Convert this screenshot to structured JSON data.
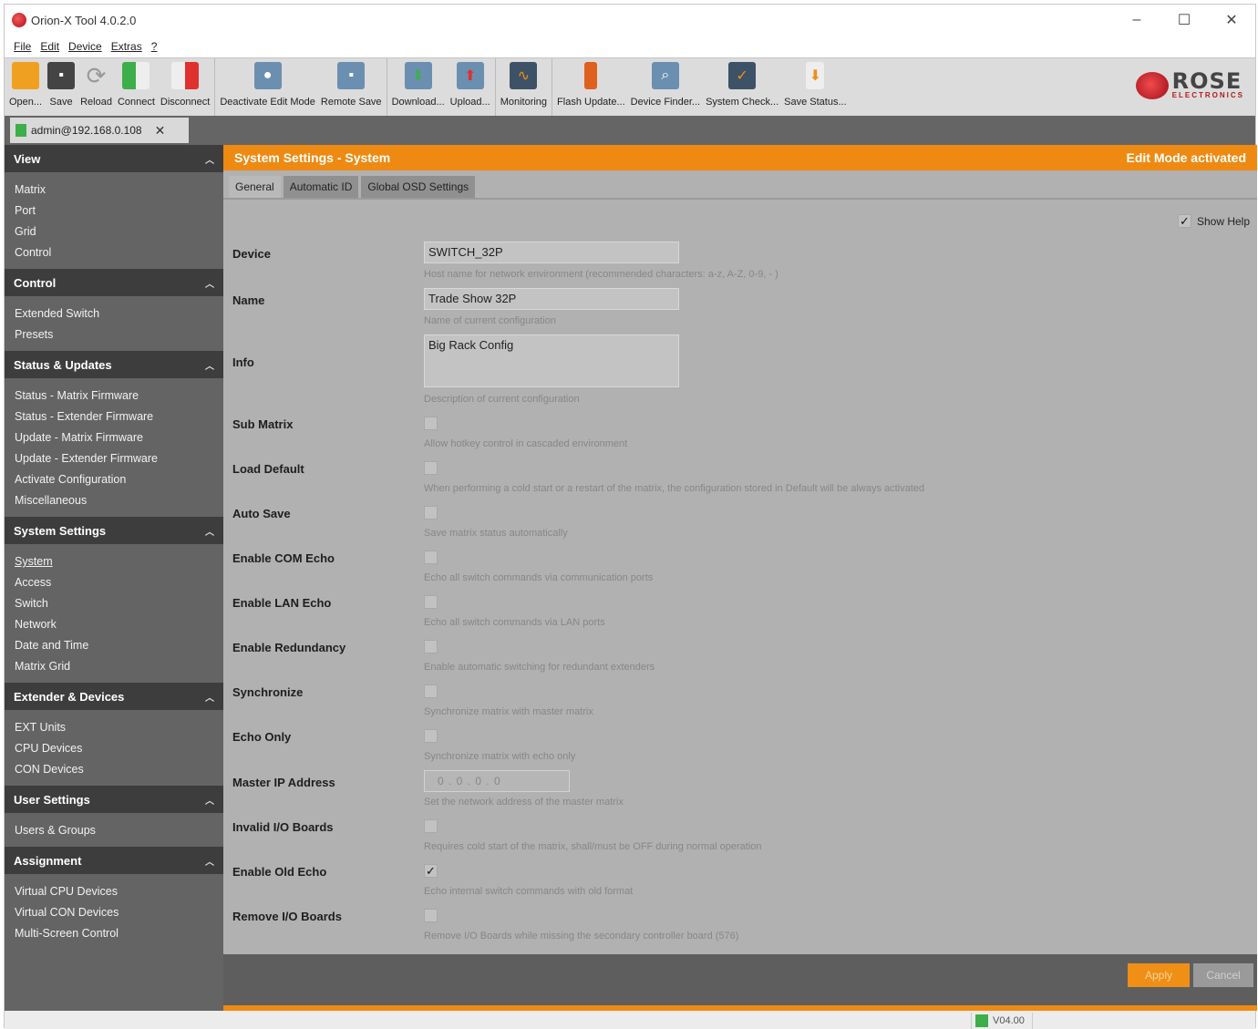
{
  "window": {
    "title": "Orion-X Tool 4.0.2.0",
    "minimize": "–",
    "maximize": "☐",
    "close": "✕"
  },
  "menu": [
    "File",
    "Edit",
    "Device",
    "Extras",
    "?"
  ],
  "toolbar": {
    "group1": [
      {
        "label": "Open...",
        "icon": "folder-icon",
        "color": "#f0a020"
      },
      {
        "label": "Save",
        "icon": "save-icon",
        "color": "#444444"
      },
      {
        "label": "Reload",
        "icon": "reload-icon",
        "color": "#aaaaaa"
      },
      {
        "label": "Connect",
        "icon": "connect-icon",
        "color": "#3eae4a"
      },
      {
        "label": "Disconnect",
        "icon": "disconnect-icon",
        "color": "#e03030"
      }
    ],
    "group2": [
      {
        "label": "Deactivate Edit Mode",
        "icon": "edit-mode-icon",
        "color": "#6b8fb0"
      },
      {
        "label": "Remote Save",
        "icon": "remote-save-icon",
        "color": "#6b8fb0"
      }
    ],
    "group3": [
      {
        "label": "Download...",
        "icon": "download-icon",
        "color": "#6b8fb0"
      },
      {
        "label": "Upload...",
        "icon": "upload-icon",
        "color": "#6b8fb0"
      }
    ],
    "group4": [
      {
        "label": "Monitoring",
        "icon": "monitoring-icon",
        "color": "#3d5266"
      }
    ],
    "group5": [
      {
        "label": "Flash Update...",
        "icon": "flash-update-icon",
        "color": "#e06020"
      },
      {
        "label": "Device Finder...",
        "icon": "device-finder-icon",
        "color": "#6b8fb0"
      },
      {
        "label": "System Check...",
        "icon": "system-check-icon",
        "color": "#3d5266"
      },
      {
        "label": "Save Status...",
        "icon": "save-status-icon",
        "color": "#eeeeee"
      }
    ],
    "brand": {
      "name": "ROSE",
      "sub": "ELECTRONICS"
    }
  },
  "session": {
    "label": "admin@192.168.0.108",
    "close": "✕"
  },
  "sidebar": {
    "sections": [
      {
        "title": "View",
        "items": [
          "Matrix",
          "Port",
          "Grid",
          "Control"
        ]
      },
      {
        "title": "Control",
        "items": [
          "Extended Switch",
          "Presets"
        ]
      },
      {
        "title": "Status & Updates",
        "items": [
          "Status - Matrix Firmware",
          "Status - Extender Firmware",
          "Update - Matrix Firmware",
          "Update - Extender Firmware",
          "Activate Configuration",
          "Miscellaneous"
        ]
      },
      {
        "title": "System Settings",
        "items": [
          "System",
          "Access",
          "Switch",
          "Network",
          "Date and Time",
          "Matrix Grid"
        ]
      },
      {
        "title": "Extender & Devices",
        "items": [
          "EXT Units",
          "CPU Devices",
          "CON Devices"
        ]
      },
      {
        "title": "User Settings",
        "items": [
          "Users & Groups"
        ]
      },
      {
        "title": "Assignment",
        "items": [
          "Virtual CPU Devices",
          "Virtual CON Devices",
          "Multi-Screen Control"
        ]
      }
    ],
    "active_item": "System"
  },
  "main": {
    "header_title": "System Settings - System",
    "header_status": "Edit Mode activated",
    "tabs": [
      "General",
      "Automatic ID",
      "Global OSD Settings"
    ],
    "show_help": {
      "label": "Show Help",
      "checked": "✓"
    },
    "device": {
      "label": "Device",
      "value": "SWITCH_32P",
      "help": "Host name for network environment (recommended characters: a-z, A-Z, 0-9, - )"
    },
    "name": {
      "label": "Name",
      "value": "Trade Show 32P",
      "help": "Name of current configuration"
    },
    "info": {
      "label": "Info",
      "value": "Big Rack Config",
      "help": "Description of current configuration"
    },
    "checks": [
      {
        "label": "Sub Matrix",
        "help": "Allow hotkey control in cascaded environment",
        "mark": ""
      },
      {
        "label": "Load Default",
        "help": "When performing a cold start or a restart of the matrix, the configuration stored in Default will be always activated",
        "mark": ""
      },
      {
        "label": "Auto Save",
        "help": "Save matrix status automatically",
        "mark": ""
      },
      {
        "label": "Enable COM Echo",
        "help": "Echo all switch commands via communication ports",
        "mark": ""
      },
      {
        "label": "Enable LAN Echo",
        "help": "Echo all switch commands via LAN ports",
        "mark": ""
      },
      {
        "label": "Enable Redundancy",
        "help": "Enable automatic switching for redundant extenders",
        "mark": ""
      },
      {
        "label": "Synchronize",
        "help": "Synchronize matrix with master matrix",
        "mark": ""
      },
      {
        "label": "Echo Only",
        "help": "Synchronize matrix with echo only",
        "mark": ""
      }
    ],
    "master_ip": {
      "label": "Master IP Address",
      "value": "0 . 0 . 0 . 0",
      "help": "Set the network address of the master matrix"
    },
    "checks2": [
      {
        "label": "Invalid I/O Boards",
        "help": "Requires cold start of the matrix, shall/must be OFF during normal operation",
        "mark": ""
      },
      {
        "label": "Enable Old Echo",
        "help": "Echo internal switch commands with old format",
        "mark": "✓"
      },
      {
        "label": "Remove I/O Boards",
        "help": "Remove I/O Boards while missing the secondary controller board (576)",
        "mark": ""
      }
    ],
    "apply": "Apply",
    "cancel": "Cancel"
  },
  "status": {
    "version": "V04.00"
  },
  "colors": {
    "accent": "#ee8a12",
    "sidebar": "#646464",
    "sidebar_header": "#3d3d3d",
    "panel": "#b1b1b1"
  }
}
